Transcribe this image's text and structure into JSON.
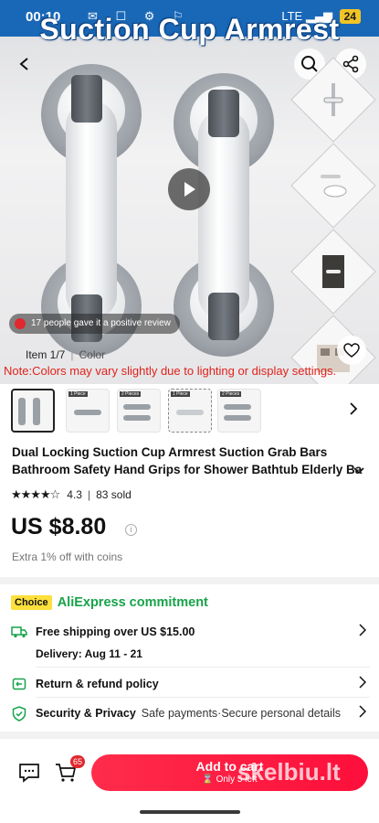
{
  "status_bar": {
    "time": "00:10",
    "network": "LTE",
    "battery": "24"
  },
  "banner": {
    "title": "Suction Cup Armrest"
  },
  "gallery": {
    "review_pill": "17 people gave it a positive review",
    "counter": "Item 1/7",
    "color_label": "Color",
    "note": "Note:Colors may vary slightly due to lighting or display settings."
  },
  "variants": {
    "tags": [
      "",
      "1 Piece",
      "2 Pieces",
      "1 Piece",
      "2 Pieces"
    ]
  },
  "product": {
    "title": "Dual Locking Suction Cup Armrest Suction Grab Bars Bathroom Safety Hand Grips for Shower Bathtub Elderly Ba",
    "stars": "★★★★☆",
    "rating": "4.3",
    "sold": "83 sold",
    "price": "US $8.80",
    "coins": "Extra 1% off with coins"
  },
  "commitment": {
    "choice_badge": "Choice",
    "title": "AliExpress commitment",
    "shipping_label": "Free shipping over US $15.00",
    "delivery": "Delivery: Aug 11 - 21",
    "return_label": "Return & refund policy",
    "security_label": "Security & Privacy",
    "security_sub": "Safe payments·Secure personal details"
  },
  "bottom": {
    "cart_count": "65",
    "add_to_cart": "Add to cart",
    "stock": "Only 5 left",
    "watermark": "skelbiu.lt"
  },
  "colors": {
    "accent_red": "#fd0f3b",
    "choice_yellow": "#fde03b",
    "commit_green": "#17a34a",
    "note_red": "#e0221b"
  }
}
